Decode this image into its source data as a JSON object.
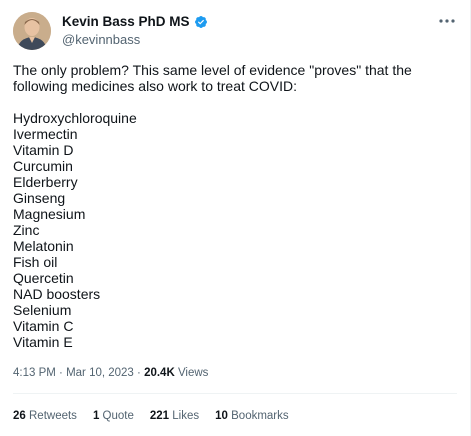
{
  "author": {
    "name": "Kevin Bass PhD MS",
    "handle": "@kevinnbass",
    "verified": true
  },
  "tweet": {
    "intro": "The only problem? This same level of evidence \"proves\" that the following medicines also work to treat COVID:",
    "medicines": [
      "Hydroxychloroquine",
      "Ivermectin",
      "Vitamin D",
      "Curcumin",
      "Elderberry",
      "Ginseng",
      "Magnesium",
      "Zinc",
      "Melatonin",
      "Fish oil",
      "Quercetin",
      "NAD boosters",
      "Selenium",
      "Vitamin C",
      "Vitamin E"
    ]
  },
  "meta": {
    "time": "4:13 PM",
    "separator": " · ",
    "date": "Mar 10, 2023",
    "views_count": "20.4K",
    "views_label": "Views"
  },
  "stats": {
    "retweets_count": "26",
    "retweets_label": "Retweets",
    "quotes_count": "1",
    "quotes_label": "Quote",
    "likes_count": "221",
    "likes_label": "Likes",
    "bookmarks_count": "10",
    "bookmarks_label": "Bookmarks"
  },
  "colors": {
    "text": "#0f1419",
    "secondary": "#536471",
    "verified": "#1d9bf0",
    "divider": "#eff3f4"
  },
  "icons": {
    "verified": "verified-badge-icon",
    "more": "more-options-icon"
  }
}
